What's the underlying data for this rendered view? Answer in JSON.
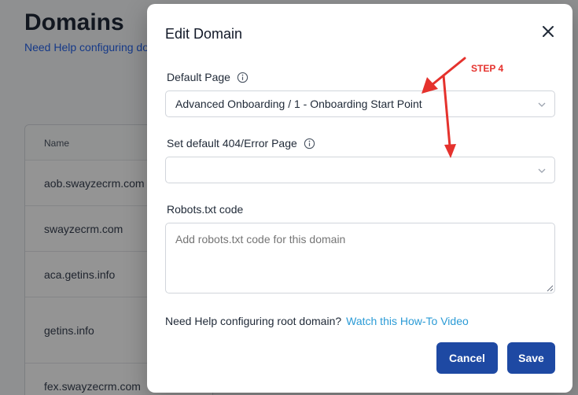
{
  "background": {
    "title": "Domains",
    "help_text": "Need Help configuring do",
    "table": {
      "header": "Name",
      "rows": [
        "aob.swayzecrm.com",
        "swayzecrm.com",
        "aca.getins.info",
        "getins.info",
        "fex.swayzecrm.com"
      ]
    }
  },
  "modal": {
    "title": "Edit Domain",
    "default_page": {
      "label": "Default Page",
      "value": "Advanced Onboarding / 1 - Onboarding Start Point"
    },
    "error_page": {
      "label": "Set default 404/Error Page",
      "value": ""
    },
    "robots": {
      "label": "Robots.txt code",
      "placeholder": "Add robots.txt code for this domain"
    },
    "help": {
      "text": "Need Help configuring root domain?",
      "link": "Watch this How-To Video"
    },
    "buttons": {
      "cancel": "Cancel",
      "save": "Save"
    }
  },
  "annotation": {
    "label": "STEP 4",
    "color": "#e5322d"
  },
  "colors": {
    "primary_button": "#1e49a3",
    "link": "#2b9bd6"
  },
  "icons": [
    "close-icon",
    "info-icon",
    "chevron-down-icon"
  ]
}
